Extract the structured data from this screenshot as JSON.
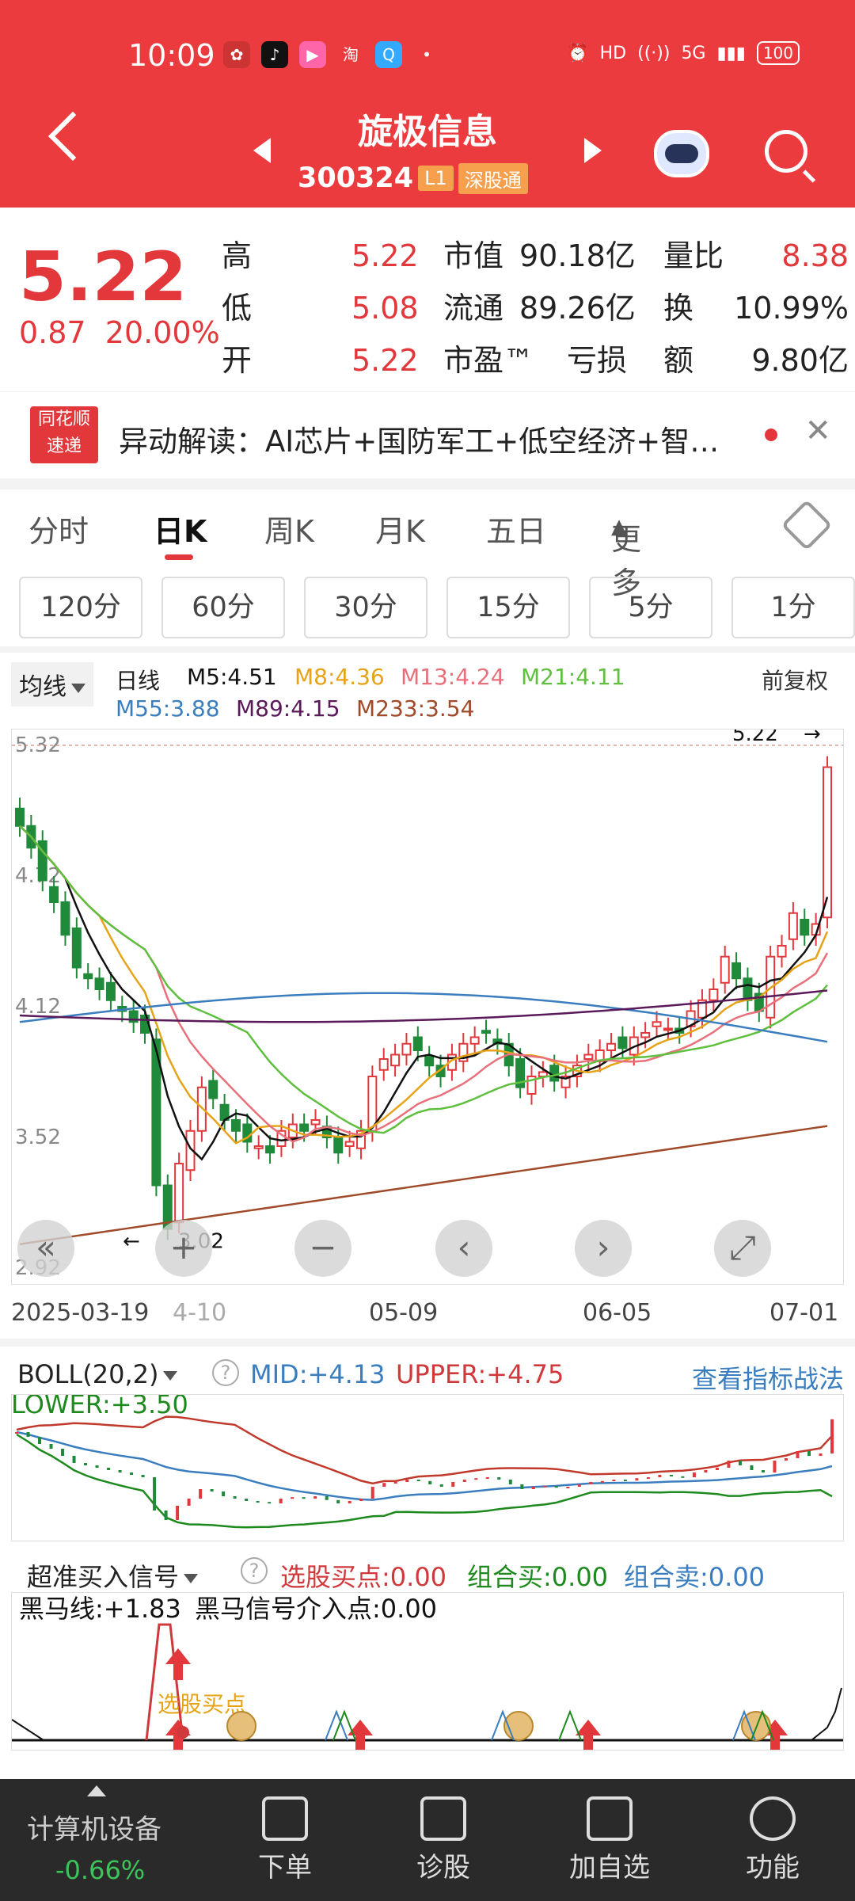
{
  "status_bar": {
    "time": "10:09",
    "hd": "HD",
    "signal": "5G",
    "battery": "100"
  },
  "header": {
    "stock_name": "旋极信息",
    "stock_code": "300324",
    "tag_level": "L1",
    "tag_connect": "深股通"
  },
  "quote": {
    "price": "5.22",
    "change": "0.87",
    "change_pct": "20.00%",
    "rows": [
      {
        "l1": "高",
        "v1": "5.22",
        "l2": "市值",
        "v2": "90.18亿",
        "l3": "量比",
        "v3": "8.38"
      },
      {
        "l1": "低",
        "v1": "5.08",
        "l2": "流通",
        "v2": "89.26亿",
        "l3": "换",
        "v3": "10.99%"
      },
      {
        "l1": "开",
        "v1": "5.22",
        "l2": "市盈™",
        "v2": "亏损",
        "l3": "额",
        "v3": "9.80亿"
      }
    ]
  },
  "banner": {
    "logo_line1": "同花顺",
    "logo_line2": "速递",
    "text": "异动解读：AI芯片+国防军工+低空经济+智…",
    "close": "✕"
  },
  "tabs": [
    "分时",
    "日K",
    "周K",
    "月K",
    "五日",
    "更多"
  ],
  "periods": [
    "120分",
    "60分",
    "30分",
    "15分",
    "5分",
    "1分"
  ],
  "kline": {
    "avg_label": "均线",
    "series_label": "日线",
    "adjust": "前复权",
    "ma": [
      {
        "name": "M5:4.51",
        "color": "#111111"
      },
      {
        "name": "M8:4.36",
        "color": "#e6a317"
      },
      {
        "name": "M13:4.24",
        "color": "#e8707a"
      },
      {
        "name": "M21:4.11",
        "color": "#5fbf3f"
      },
      {
        "name": "M55:3.88",
        "color": "#3a7ebf"
      },
      {
        "name": "M89:4.15",
        "color": "#5a1a5a"
      },
      {
        "name": "M233:3.54",
        "color": "#a04a2a"
      }
    ],
    "y_ticks": [
      "5.32",
      "4.72",
      "4.12",
      "3.52",
      "2.92"
    ],
    "high_label": "5.22",
    "low_label": "3.02",
    "x_ticks": [
      "2025-03-19",
      "4-10",
      "05-09",
      "06-05",
      "07-01"
    ],
    "controls": [
      "«",
      "+",
      "−",
      "‹",
      "›",
      "⤢"
    ]
  },
  "boll": {
    "name": "BOLL(20,2)",
    "mid": "MID:+4.13",
    "upper": "UPPER:+4.75",
    "lower": "LOWER:+3.50",
    "link": "查看指标战法"
  },
  "signal": {
    "name": "超准买入信号",
    "pick": "选股买点:0.00",
    "combo_buy": "组合买:0.00",
    "combo_sell": "组合卖:0.00",
    "horse_line": "黑马线:+1.83",
    "horse_entry": "黑马信号介入点:0.00",
    "annot": "选股买点"
  },
  "bottom_nav": {
    "sector": "计算机设备",
    "sector_chg": "-0.66%",
    "items": [
      "下单",
      "诊股",
      "加自选",
      "功能"
    ]
  },
  "chart_data": {
    "type": "candlestick",
    "title": "",
    "x_start": "2025-03-19",
    "x_end": "2025-07-01",
    "ylim": [
      2.92,
      5.32
    ],
    "close": [
      4.95,
      4.85,
      4.7,
      4.6,
      4.45,
      4.3,
      4.25,
      4.2,
      4.15,
      4.1,
      4.05,
      4.0,
      3.3,
      3.1,
      3.4,
      3.55,
      3.75,
      3.7,
      3.6,
      3.55,
      3.5,
      3.48,
      3.45,
      3.55,
      3.58,
      3.55,
      3.6,
      3.52,
      3.45,
      3.5,
      3.55,
      3.8,
      3.88,
      3.9,
      3.95,
      3.92,
      3.85,
      3.8,
      3.9,
      3.95,
      3.98,
      4.0,
      3.95,
      3.85,
      3.75,
      3.8,
      3.82,
      3.78,
      3.8,
      3.85,
      3.9,
      3.92,
      3.95,
      3.93,
      3.98,
      4.0,
      4.05,
      4.02,
      4.0,
      4.1,
      4.15,
      4.2,
      4.35,
      4.25,
      4.15,
      4.1,
      4.35,
      4.4,
      4.55,
      4.45,
      4.5,
      5.22
    ]
  }
}
